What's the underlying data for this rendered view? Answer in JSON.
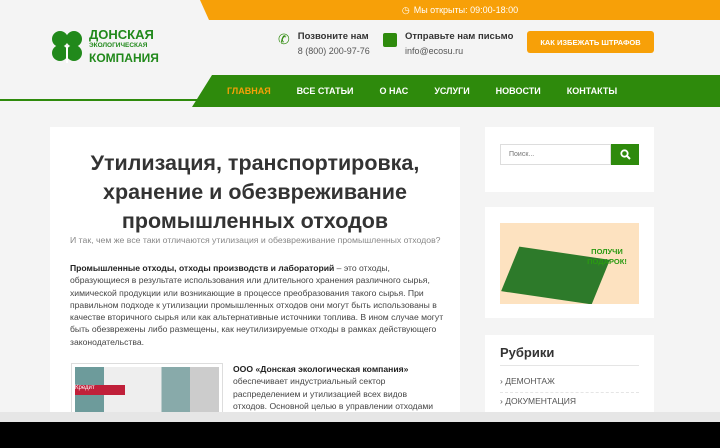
{
  "topbar": {
    "hours": "Мы открыты: 09:00-18:00"
  },
  "logo": {
    "line1": "ДОНСКАЯ",
    "line2": "ЭКОЛОГИЧЕСКАЯ",
    "line3": "КОМПАНИЯ"
  },
  "contacts": [
    {
      "label": "Позвоните нам",
      "value": "8 (800) 200-97-76"
    },
    {
      "label": "Отправьте нам письмо",
      "value": "info@ecosu.ru"
    }
  ],
  "cta": "КАК ИЗБЕЖАТЬ ШТРАФОВ",
  "nav": [
    "ГЛАВНАЯ",
    "ВСЕ СТАТЬИ",
    "О НАС",
    "УСЛУГИ",
    "НОВОСТИ",
    "КОНТАКТЫ"
  ],
  "article": {
    "title": "Утилизация, транспортировка, хранение и обезвреживание промышленных отходов",
    "subtitle": "И так, чем же все таки отличаются утилизация и обезвреживание промышленных отходов?",
    "para_bold": "Промышленные отходы, отходы производств и лабораторий",
    "para_rest": " – это отходы, образующиеся в результате использования или длительного хранения различного сырья, химической продукции или возникающие в процессе преобразования такого сырья. При правильном подходе к утилизации промышленных отходов они могут быть использованы в качестве вторичного сырья или как альтернативные источники топлива. В ином случае могут быть обезврежены либо размещены, как неутилизируемые отходы в рамках действующего законодательства.",
    "company_bold": "ООО «Донская экологическая компания»",
    "company_rest": " обеспечивает индустриальный сектор распределением и утилизацией всех видов отходов. Основной целью в управлении отходами является",
    "photo_sign": "Кредит"
  },
  "sidebar": {
    "search_placeholder": "Поиск...",
    "banner": "ПОЛУЧИ ПОДАРОК!",
    "rubrics_title": "Рубрики",
    "rubrics": [
      "ДЕМОНТАЖ",
      "ДОКУМЕНТАЦИЯ"
    ]
  }
}
